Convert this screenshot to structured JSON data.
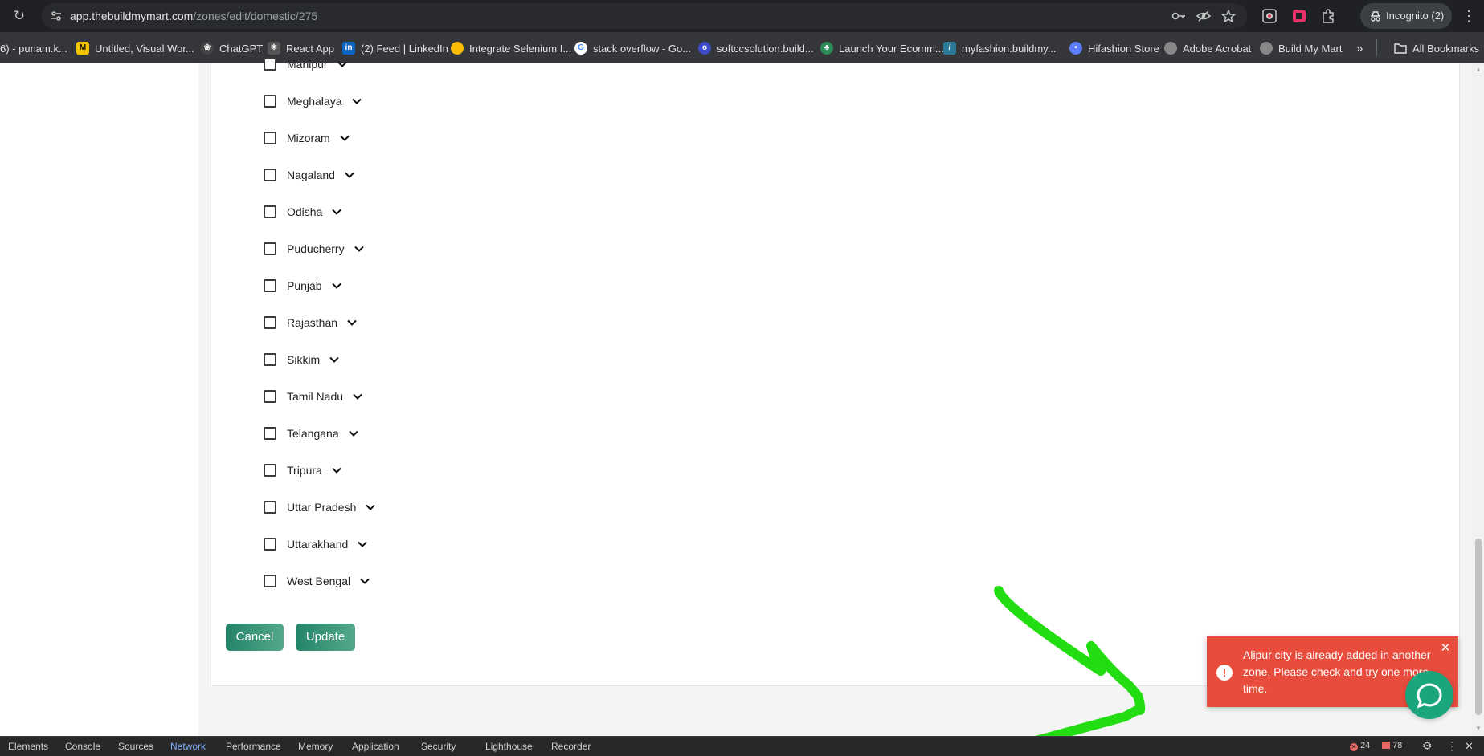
{
  "browser": {
    "url_host": "app.thebuildmymart.com",
    "url_path": "/zones/edit/domestic/275",
    "profile_label": "Incognito (2)"
  },
  "bookmarks": [
    {
      "label": "6) - punam.k...",
      "icon": "tab-icon",
      "color": "#5f6368"
    },
    {
      "label": "Untitled, Visual Wor...",
      "icon": "miro-icon",
      "color": "#f7c500"
    },
    {
      "label": "ChatGPT",
      "icon": "chatgpt-icon",
      "color": "#444"
    },
    {
      "label": "React App",
      "icon": "react-icon",
      "color": "#555"
    },
    {
      "label": "(2) Feed | LinkedIn",
      "icon": "linkedin-icon",
      "color": "#0a66c2"
    },
    {
      "label": "Integrate Selenium I...",
      "icon": "chrome-icon",
      "color": "#fbbc04"
    },
    {
      "label": "stack overflow - Go...",
      "icon": "google-icon",
      "color": "#4285f4"
    },
    {
      "label": "softccsolution.build...",
      "icon": "site-icon",
      "color": "#3b4cca"
    },
    {
      "label": "Launch Your Ecomm...",
      "icon": "leaf-icon",
      "color": "#2e8b57"
    },
    {
      "label": "myfashion.buildmy...",
      "icon": "feather-icon",
      "color": "#2a7a9a"
    },
    {
      "label": "Hifashion Store",
      "icon": "pin-icon",
      "color": "#5c7cfa"
    },
    {
      "label": "Adobe Acrobat",
      "icon": "globe-icon",
      "color": "#888"
    },
    {
      "label": "Build My Mart",
      "icon": "globe-icon",
      "color": "#888"
    }
  ],
  "all_bookmarks_label": "All Bookmarks",
  "states": [
    "Manipur",
    "Meghalaya",
    "Mizoram",
    "Nagaland",
    "Odisha",
    "Puducherry",
    "Punjab",
    "Rajasthan",
    "Sikkim",
    "Tamil Nadu",
    "Telangana",
    "Tripura",
    "Uttar Pradesh",
    "Uttarakhand",
    "West Bengal"
  ],
  "actions": {
    "cancel": "Cancel",
    "update": "Update"
  },
  "toast": {
    "message": "Alipur city is already added in another zone. Please check and try one more time.",
    "color": "#e74c3c"
  },
  "annotation_color": "#22dd11",
  "devtools": {
    "tabs": [
      "Elements",
      "Console",
      "Sources",
      "Network",
      "Performance",
      "Memory",
      "Application",
      "Security",
      "Lighthouse",
      "Recorder"
    ],
    "active_tab": "Network",
    "errors": "24",
    "warnings": "78"
  }
}
